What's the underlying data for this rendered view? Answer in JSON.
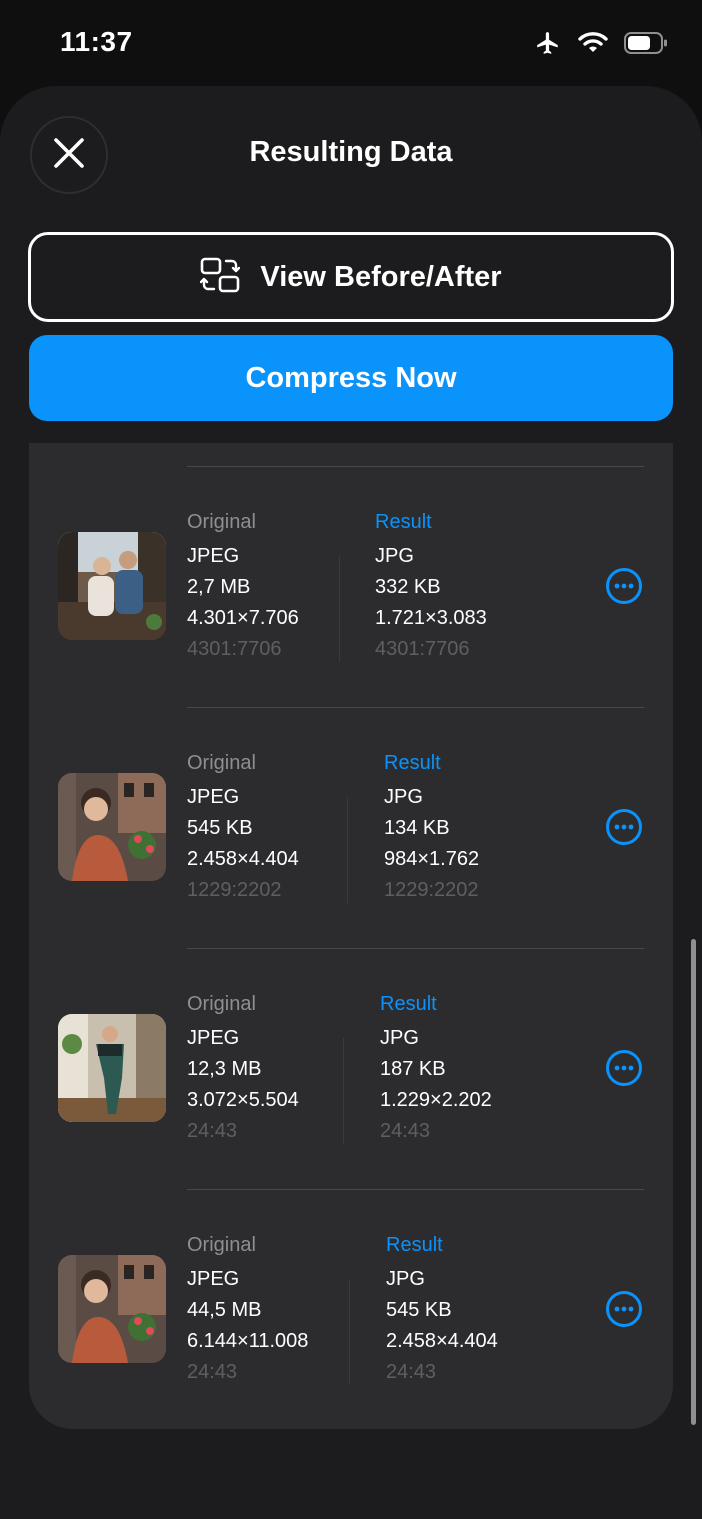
{
  "status": {
    "time": "11:37"
  },
  "header": {
    "title": "Resulting Data"
  },
  "actions": {
    "view_before_after": "View Before/After",
    "compress_now": "Compress Now"
  },
  "labels": {
    "original": "Original",
    "result": "Result"
  },
  "items": [
    {
      "original": {
        "format": "JPEG",
        "size": "2,7 MB",
        "dims": "4.301×7.706",
        "ratio": "4301:7706"
      },
      "result": {
        "format": "JPG",
        "size": "332 KB",
        "dims": "1.721×3.083",
        "ratio": "4301:7706"
      }
    },
    {
      "original": {
        "format": "JPEG",
        "size": "545 KB",
        "dims": "2.458×4.404",
        "ratio": "1229:2202"
      },
      "result": {
        "format": "JPG",
        "size": "134 KB",
        "dims": "984×1.762",
        "ratio": "1229:2202"
      }
    },
    {
      "original": {
        "format": "JPEG",
        "size": "12,3 MB",
        "dims": "3.072×5.504",
        "ratio": "24:43"
      },
      "result": {
        "format": "JPG",
        "size": "187 KB",
        "dims": "1.229×2.202",
        "ratio": "24:43"
      }
    },
    {
      "original": {
        "format": "JPEG",
        "size": "44,5 MB",
        "dims": "6.144×11.008",
        "ratio": "24:43"
      },
      "result": {
        "format": "JPG",
        "size": "545 KB",
        "dims": "2.458×4.404",
        "ratio": "24:43"
      }
    }
  ],
  "icons": {
    "close": "close-icon",
    "compare": "compare-icon",
    "more": "ellipsis-circle-icon",
    "airplane": "airplane-icon",
    "wifi": "wifi-icon",
    "battery": "battery-icon"
  },
  "colors": {
    "accent": "#0a93fb",
    "sheet": "#1c1c1e",
    "panel": "#2c2c2e",
    "background": "#0f0f10"
  }
}
